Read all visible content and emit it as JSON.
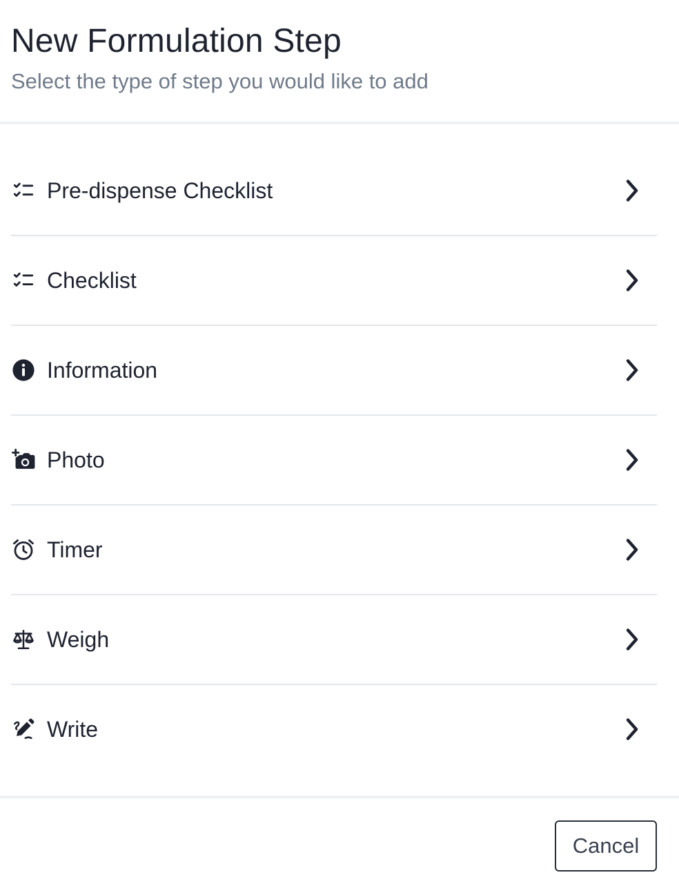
{
  "dialog": {
    "title": "New Formulation Step",
    "subtitle": "Select the type of step you would like to add"
  },
  "steps": [
    {
      "label": "Pre-dispense Checklist",
      "icon": "checklist-icon"
    },
    {
      "label": "Checklist",
      "icon": "checklist-icon"
    },
    {
      "label": "Information",
      "icon": "info-icon"
    },
    {
      "label": "Photo",
      "icon": "camera-add-icon"
    },
    {
      "label": "Timer",
      "icon": "alarm-clock-icon"
    },
    {
      "label": "Weigh",
      "icon": "scale-icon"
    },
    {
      "label": "Write",
      "icon": "pen-icon"
    }
  ],
  "footer": {
    "cancel_label": "Cancel"
  },
  "colors": {
    "text": "#1f2330",
    "subtitle": "#6f7a8a",
    "divider": "#e3e6ea"
  }
}
